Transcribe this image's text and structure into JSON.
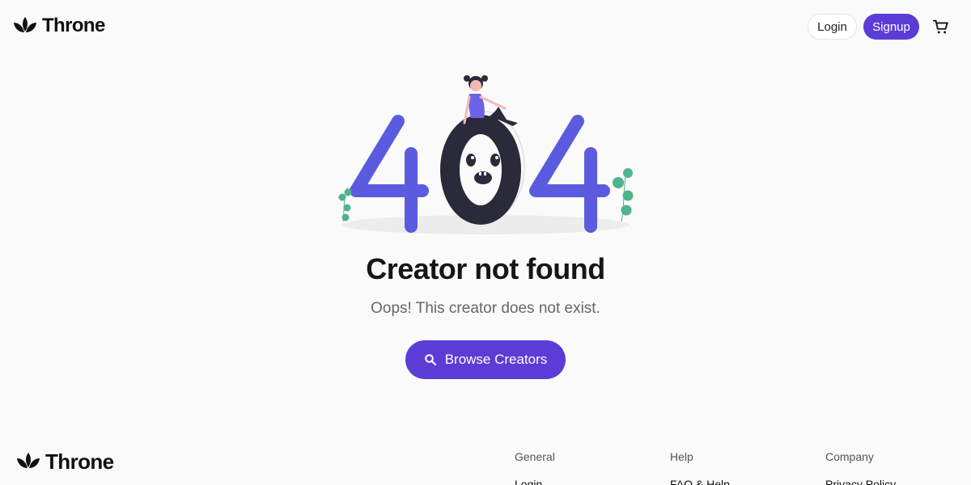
{
  "header": {
    "brand": "Throne",
    "login_label": "Login",
    "signup_label": "Signup",
    "cart_icon": "cart-icon"
  },
  "illustration": {
    "text": "404",
    "accent_color": "#5b5be0",
    "dark_color": "#2b2a3a",
    "plant_color": "#4fb48a"
  },
  "main": {
    "title": "Creator not found",
    "subtitle": "Oops! This creator does not exist.",
    "browse_label": "Browse Creators",
    "browse_icon": "search-icon"
  },
  "footer": {
    "brand": "Throne",
    "columns": [
      {
        "heading": "General",
        "first_link": "Login"
      },
      {
        "heading": "Help",
        "first_link": "FAQ & Help"
      },
      {
        "heading": "Company",
        "first_link": "Privacy Policy"
      }
    ]
  },
  "colors": {
    "primary": "#5b3cd6",
    "background": "#fafafa",
    "text": "#161616",
    "muted": "#666666"
  }
}
